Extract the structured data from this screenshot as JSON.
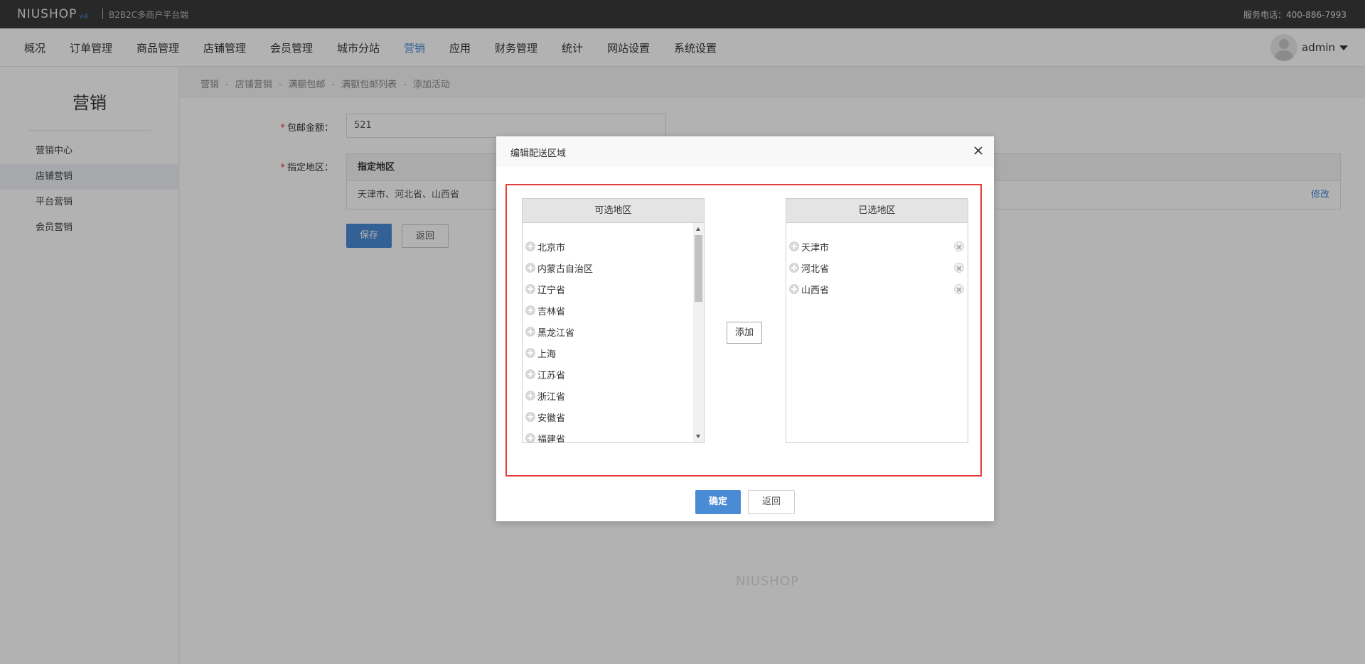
{
  "topbar": {
    "logo": "NIUSHOP",
    "logo_version": "v4",
    "subtitle": "B2B2C多商户平台端",
    "service_phone": "服务电话：400-886-7993"
  },
  "nav": {
    "items": [
      "概况",
      "订单管理",
      "商品管理",
      "店铺管理",
      "会员管理",
      "城市分站",
      "营销",
      "应用",
      "财务管理",
      "统计",
      "网站设置",
      "系统设置"
    ],
    "active": "营销",
    "username": "admin"
  },
  "sidebar": {
    "title": "营销",
    "items": [
      "营销中心",
      "店铺营销",
      "平台营销",
      "会员营销"
    ],
    "active": "店铺营销"
  },
  "breadcrumb": [
    "营销",
    "店铺营销",
    "满额包邮",
    "满额包邮列表",
    "添加活动"
  ],
  "form": {
    "amount_label": "包邮金额：",
    "amount_value": "521",
    "region_label": "指定地区：",
    "region_header": "指定地区",
    "region_value": "天津市、河北省、山西省",
    "edit_label": "修改",
    "save_label": "保存",
    "back_label": "返回"
  },
  "footer_logo": "NIUSHOP",
  "modal": {
    "title": "编辑配送区域",
    "available_title": "可选地区",
    "selected_title": "已选地区",
    "available": [
      "北京市",
      "内蒙古自治区",
      "辽宁省",
      "吉林省",
      "黑龙江省",
      "上海",
      "江苏省",
      "浙江省",
      "安徽省",
      "福建省"
    ],
    "selected": [
      "天津市",
      "河北省",
      "山西省"
    ],
    "add_label": "添加",
    "confirm_label": "确定",
    "cancel_label": "返回",
    "highlight_color": "#e43d3d"
  },
  "colors": {
    "accent": "#4a8bd6",
    "topbar": "#3a3a3a"
  }
}
